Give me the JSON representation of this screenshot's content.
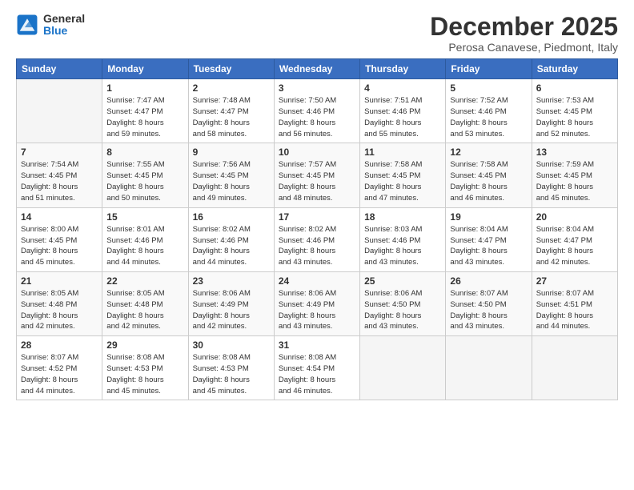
{
  "header": {
    "logo_general": "General",
    "logo_blue": "Blue",
    "title": "December 2025",
    "subtitle": "Perosa Canavese, Piedmont, Italy"
  },
  "weekdays": [
    "Sunday",
    "Monday",
    "Tuesday",
    "Wednesday",
    "Thursday",
    "Friday",
    "Saturday"
  ],
  "weeks": [
    [
      {
        "day": "",
        "sunrise": "",
        "sunset": "",
        "daylight": ""
      },
      {
        "day": "1",
        "sunrise": "7:47 AM",
        "sunset": "4:47 PM",
        "daylight": "8 hours and 59 minutes."
      },
      {
        "day": "2",
        "sunrise": "7:48 AM",
        "sunset": "4:47 PM",
        "daylight": "8 hours and 58 minutes."
      },
      {
        "day": "3",
        "sunrise": "7:50 AM",
        "sunset": "4:46 PM",
        "daylight": "8 hours and 56 minutes."
      },
      {
        "day": "4",
        "sunrise": "7:51 AM",
        "sunset": "4:46 PM",
        "daylight": "8 hours and 55 minutes."
      },
      {
        "day": "5",
        "sunrise": "7:52 AM",
        "sunset": "4:46 PM",
        "daylight": "8 hours and 53 minutes."
      },
      {
        "day": "6",
        "sunrise": "7:53 AM",
        "sunset": "4:45 PM",
        "daylight": "8 hours and 52 minutes."
      }
    ],
    [
      {
        "day": "7",
        "sunrise": "7:54 AM",
        "sunset": "4:45 PM",
        "daylight": "8 hours and 51 minutes."
      },
      {
        "day": "8",
        "sunrise": "7:55 AM",
        "sunset": "4:45 PM",
        "daylight": "8 hours and 50 minutes."
      },
      {
        "day": "9",
        "sunrise": "7:56 AM",
        "sunset": "4:45 PM",
        "daylight": "8 hours and 49 minutes."
      },
      {
        "day": "10",
        "sunrise": "7:57 AM",
        "sunset": "4:45 PM",
        "daylight": "8 hours and 48 minutes."
      },
      {
        "day": "11",
        "sunrise": "7:58 AM",
        "sunset": "4:45 PM",
        "daylight": "8 hours and 47 minutes."
      },
      {
        "day": "12",
        "sunrise": "7:58 AM",
        "sunset": "4:45 PM",
        "daylight": "8 hours and 46 minutes."
      },
      {
        "day": "13",
        "sunrise": "7:59 AM",
        "sunset": "4:45 PM",
        "daylight": "8 hours and 45 minutes."
      }
    ],
    [
      {
        "day": "14",
        "sunrise": "8:00 AM",
        "sunset": "4:45 PM",
        "daylight": "8 hours and 45 minutes."
      },
      {
        "day": "15",
        "sunrise": "8:01 AM",
        "sunset": "4:46 PM",
        "daylight": "8 hours and 44 minutes."
      },
      {
        "day": "16",
        "sunrise": "8:02 AM",
        "sunset": "4:46 PM",
        "daylight": "8 hours and 44 minutes."
      },
      {
        "day": "17",
        "sunrise": "8:02 AM",
        "sunset": "4:46 PM",
        "daylight": "8 hours and 43 minutes."
      },
      {
        "day": "18",
        "sunrise": "8:03 AM",
        "sunset": "4:46 PM",
        "daylight": "8 hours and 43 minutes."
      },
      {
        "day": "19",
        "sunrise": "8:04 AM",
        "sunset": "4:47 PM",
        "daylight": "8 hours and 43 minutes."
      },
      {
        "day": "20",
        "sunrise": "8:04 AM",
        "sunset": "4:47 PM",
        "daylight": "8 hours and 42 minutes."
      }
    ],
    [
      {
        "day": "21",
        "sunrise": "8:05 AM",
        "sunset": "4:48 PM",
        "daylight": "8 hours and 42 minutes."
      },
      {
        "day": "22",
        "sunrise": "8:05 AM",
        "sunset": "4:48 PM",
        "daylight": "8 hours and 42 minutes."
      },
      {
        "day": "23",
        "sunrise": "8:06 AM",
        "sunset": "4:49 PM",
        "daylight": "8 hours and 42 minutes."
      },
      {
        "day": "24",
        "sunrise": "8:06 AM",
        "sunset": "4:49 PM",
        "daylight": "8 hours and 43 minutes."
      },
      {
        "day": "25",
        "sunrise": "8:06 AM",
        "sunset": "4:50 PM",
        "daylight": "8 hours and 43 minutes."
      },
      {
        "day": "26",
        "sunrise": "8:07 AM",
        "sunset": "4:50 PM",
        "daylight": "8 hours and 43 minutes."
      },
      {
        "day": "27",
        "sunrise": "8:07 AM",
        "sunset": "4:51 PM",
        "daylight": "8 hours and 44 minutes."
      }
    ],
    [
      {
        "day": "28",
        "sunrise": "8:07 AM",
        "sunset": "4:52 PM",
        "daylight": "8 hours and 44 minutes."
      },
      {
        "day": "29",
        "sunrise": "8:08 AM",
        "sunset": "4:53 PM",
        "daylight": "8 hours and 45 minutes."
      },
      {
        "day": "30",
        "sunrise": "8:08 AM",
        "sunset": "4:53 PM",
        "daylight": "8 hours and 45 minutes."
      },
      {
        "day": "31",
        "sunrise": "8:08 AM",
        "sunset": "4:54 PM",
        "daylight": "8 hours and 46 minutes."
      },
      {
        "day": "",
        "sunrise": "",
        "sunset": "",
        "daylight": ""
      },
      {
        "day": "",
        "sunrise": "",
        "sunset": "",
        "daylight": ""
      },
      {
        "day": "",
        "sunrise": "",
        "sunset": "",
        "daylight": ""
      }
    ]
  ]
}
